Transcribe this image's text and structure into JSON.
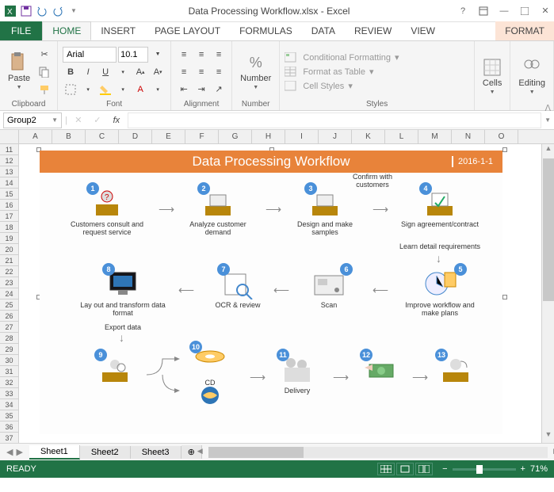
{
  "title": "Data Processing Workflow.xlsx - Excel",
  "tabs": {
    "file": "FILE",
    "home": "HOME",
    "insert": "INSERT",
    "page": "PAGE LAYOUT",
    "formulas": "FORMULAS",
    "data": "DATA",
    "review": "REVIEW",
    "view": "VIEW",
    "format": "FORMAT"
  },
  "ribbon": {
    "paste": "Paste",
    "clipboard": "Clipboard",
    "font": "Font",
    "font_name": "Arial",
    "font_size": "10.1",
    "alignment": "Alignment",
    "number": "Number",
    "pct": "%",
    "styles": "Styles",
    "cf": "Conditional Formatting",
    "fat": "Format as Table",
    "cs": "Cell Styles",
    "cells": "Cells",
    "editing": "Editing"
  },
  "namebox": "Group2",
  "fx": "fx",
  "cols": [
    "A",
    "B",
    "C",
    "D",
    "E",
    "F",
    "G",
    "H",
    "I",
    "J",
    "K",
    "L",
    "M",
    "N",
    "O"
  ],
  "row_start": 11,
  "row_end": 37,
  "banner": {
    "title": "Data Processing Workflow",
    "date": "2016-1-1"
  },
  "nodes": {
    "1": "Customers consult and request service",
    "2": "Analyze customer demand",
    "3": "Design and make samples",
    "3a": "Confirm with customers",
    "4": "Sign agreement/contract",
    "4a": "Learn detail requirements",
    "5": "Improve workflow and make plans",
    "6": "Scan",
    "7": "OCR & review",
    "8": "Lay out and transform data  format",
    "8a": "Export data",
    "10": "CD",
    "11": "Delivery"
  },
  "sheets": {
    "s1": "Sheet1",
    "s2": "Sheet2",
    "s3": "Sheet3"
  },
  "status": {
    "ready": "READY",
    "zoom": "71%"
  }
}
